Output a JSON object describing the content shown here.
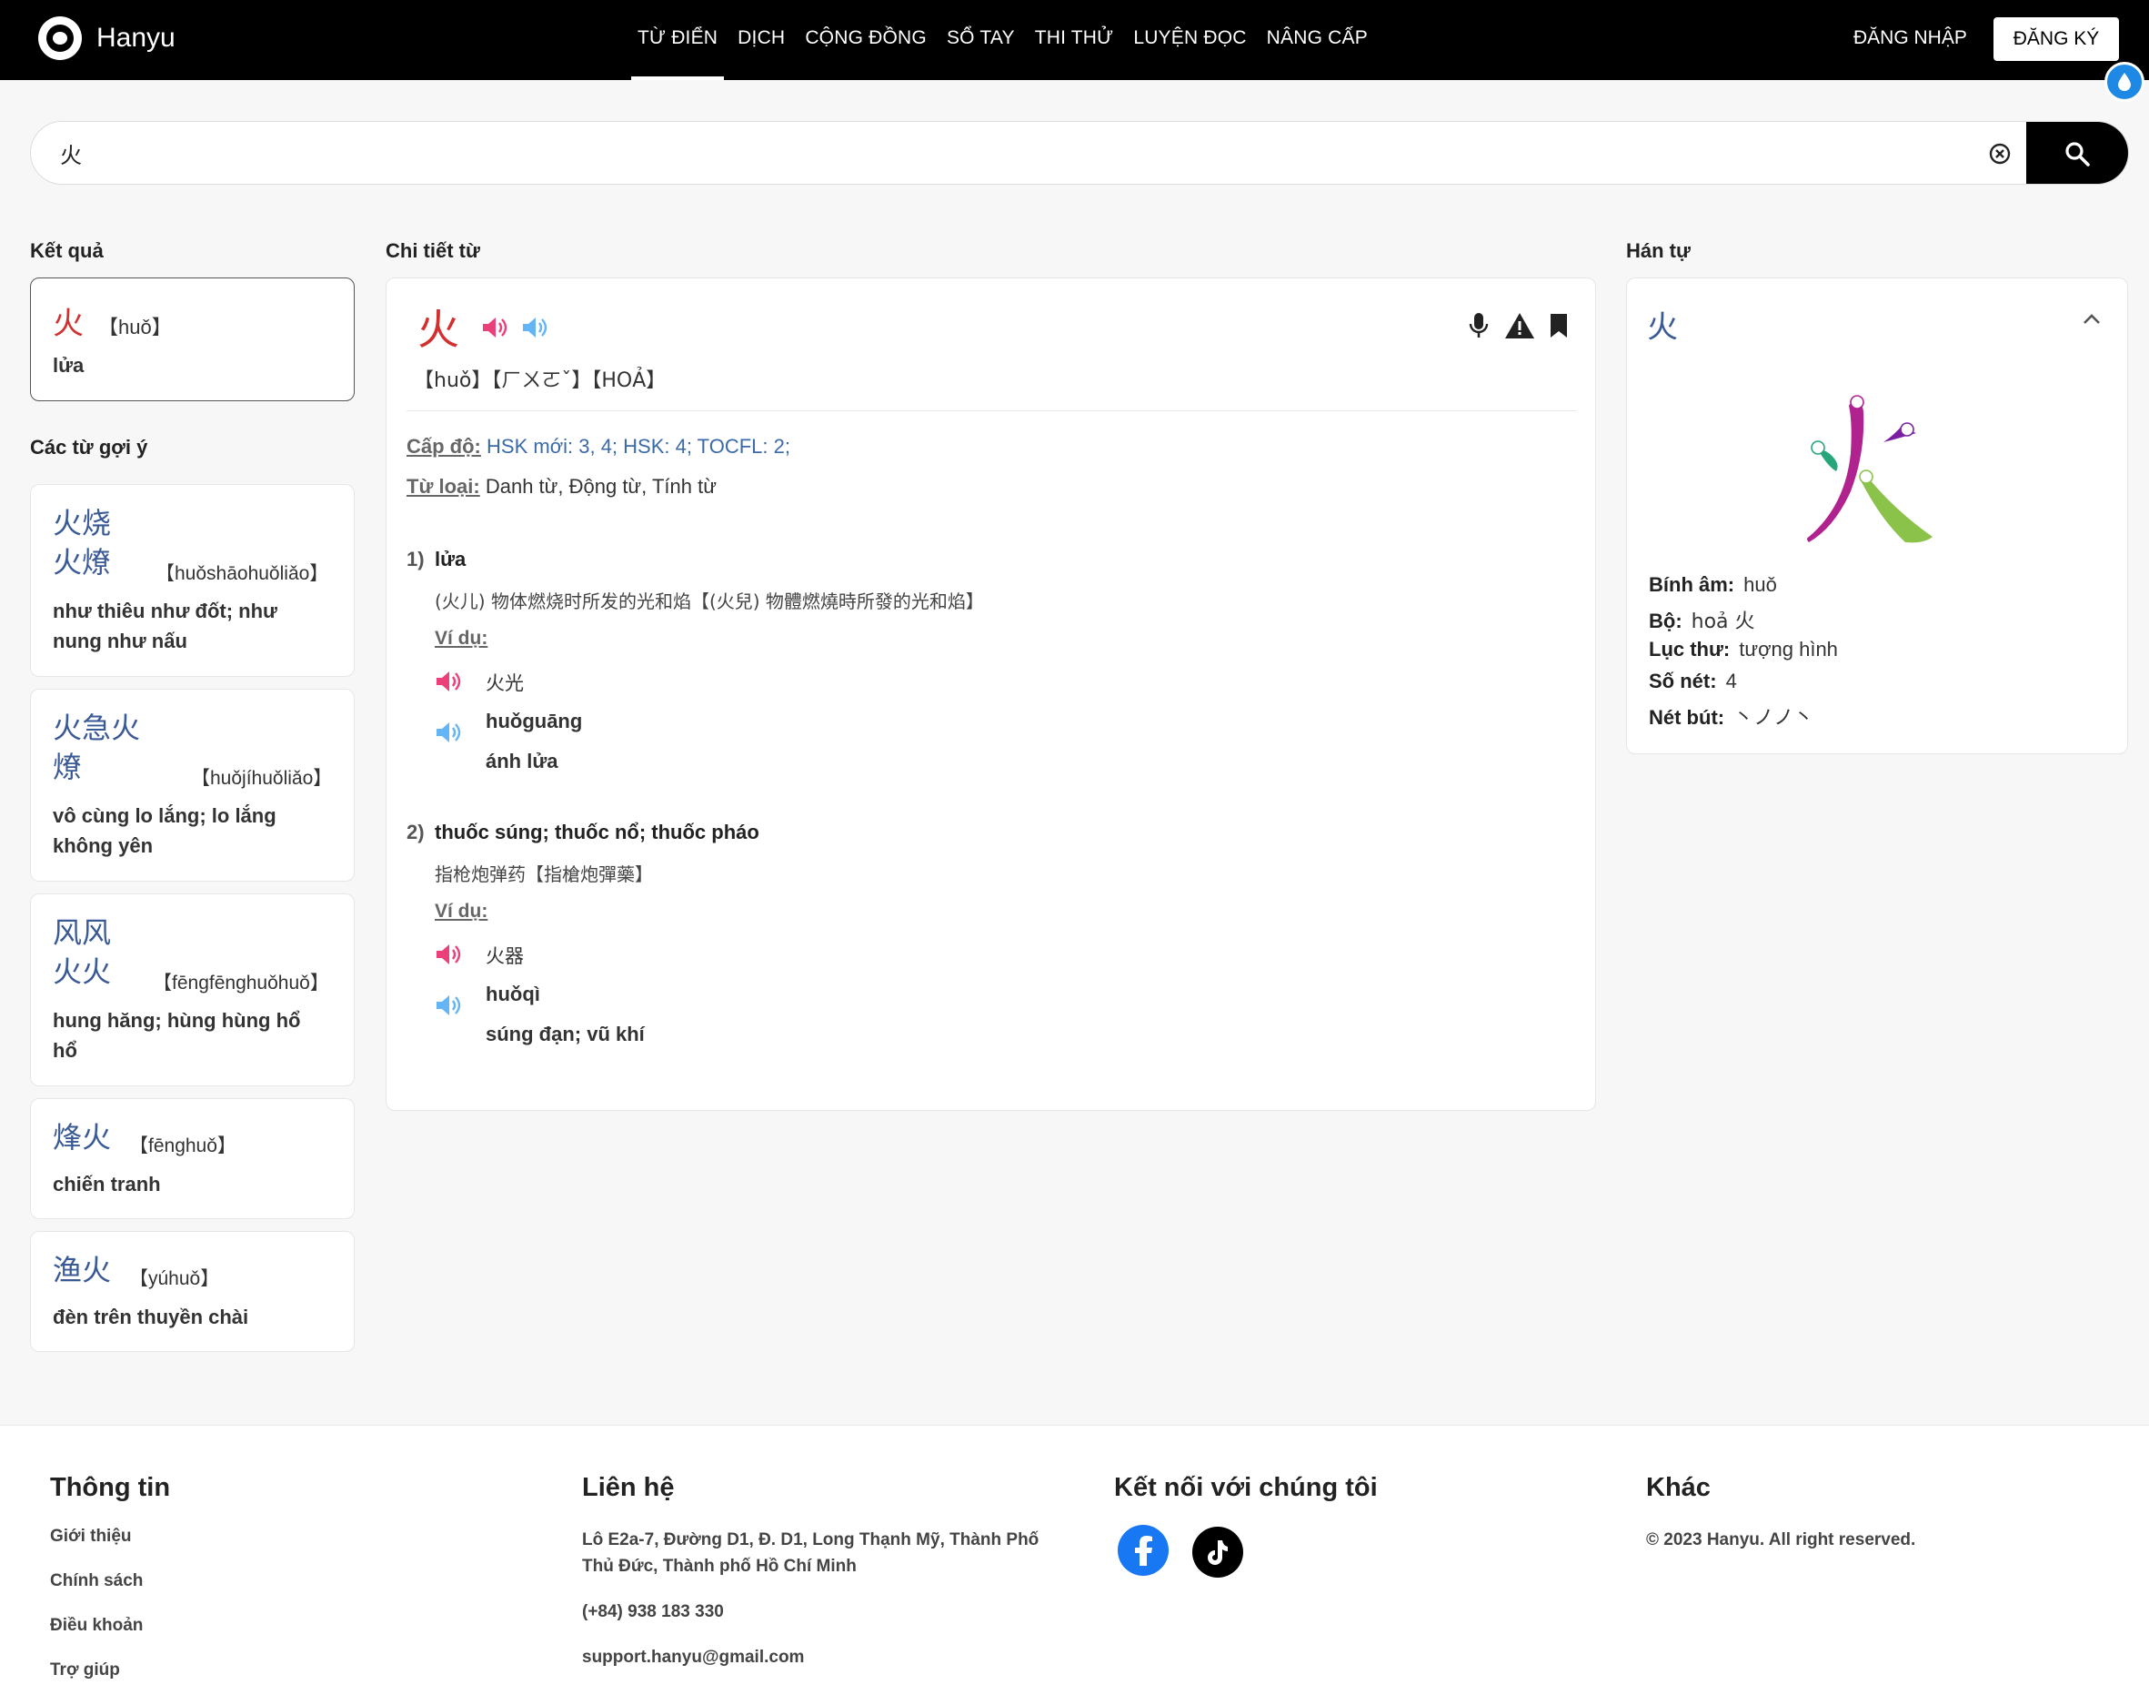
{
  "header": {
    "brand": "Hanyu",
    "nav": [
      {
        "label": "TỪ ĐIỂN",
        "active": true
      },
      {
        "label": "DỊCH"
      },
      {
        "label": "CỘNG ĐỒNG"
      },
      {
        "label": "SỔ TAY"
      },
      {
        "label": "THI THỬ"
      },
      {
        "label": "LUYỆN ĐỌC"
      },
      {
        "label": "NÂNG CẤP"
      }
    ],
    "login": "ĐĂNG NHẬP",
    "signup": "ĐĂNG KÝ"
  },
  "search": {
    "value": "火"
  },
  "results": {
    "title": "Kết quả",
    "item": {
      "hanzi": "火",
      "pinyin": "【huǒ】",
      "meaning": "lửa"
    }
  },
  "suggestions": {
    "title": "Các từ gợi ý",
    "items": [
      {
        "hanzi_line1": "火烧",
        "hanzi_line2": "火燎",
        "pinyin": "【huǒshāohuǒliǎo】",
        "meaning": "như thiêu như đốt; như nung như nấu"
      },
      {
        "hanzi_line1": "火急火",
        "hanzi_line2": "燎",
        "pinyin": "【huǒjíhuǒliǎo】",
        "meaning": "vô cùng lo lắng; lo lắng không yên"
      },
      {
        "hanzi_line1": "风风",
        "hanzi_line2": "火火",
        "pinyin": "【fēngfēnghuǒhuǒ】",
        "meaning": "hung hăng; hùng hùng hổ hổ"
      },
      {
        "hanzi_line1": "烽火",
        "hanzi_line2": "",
        "pinyin": "【fēnghuǒ】",
        "meaning": "chiến tranh"
      },
      {
        "hanzi_line1": "渔火",
        "hanzi_line2": "",
        "pinyin": "【yúhuǒ】",
        "meaning": "đèn trên thuyền chài"
      }
    ]
  },
  "detail": {
    "title": "Chi tiết từ",
    "hanzi": "火",
    "readings": "【huǒ】【ㄏㄨㄛˇ】【HOẢ】",
    "level_label": "Cấp độ:",
    "level_value": "HSK mới: 3, 4; HSK: 4; TOCFL: 2;",
    "pos_label": "Từ loại:",
    "pos_value": "Danh từ, Động từ, Tính từ",
    "example_label": "Ví dụ:",
    "senses": [
      {
        "num": "1)",
        "meaning": "lửa",
        "explain": "(火儿) 物体燃烧时所发的光和焰【(火兒) 物體燃燒時所發的光和焰】",
        "ex_hanzi": "火光",
        "ex_pinyin": "huǒguāng",
        "ex_meaning": "ánh lửa"
      },
      {
        "num": "2)",
        "meaning": "thuốc súng; thuốc nổ; thuốc pháo",
        "explain": "指枪炮弹药【指槍炮彈藥】",
        "ex_hanzi": "火器",
        "ex_pinyin": "huǒqì",
        "ex_meaning": "súng đạn; vũ khí"
      }
    ]
  },
  "hantu": {
    "title": "Hán tự",
    "char": "火",
    "props": [
      {
        "label": "Bính âm:",
        "value": "huǒ"
      },
      {
        "label": "Bộ:",
        "value": "hoả 火"
      },
      {
        "label": "Lục thư:",
        "value": "tượng hình"
      },
      {
        "label": "Số nét:",
        "value": "4"
      },
      {
        "label": "Nét bút:",
        "value": "丶ノノ丶"
      }
    ]
  },
  "footer": {
    "info_title": "Thông tin",
    "info_links": [
      "Giới thiệu",
      "Chính sách",
      "Điều khoản",
      "Trợ giúp"
    ],
    "contact_title": "Liên hệ",
    "address": "Lô E2a-7, Đường D1, Đ. D1, Long Thạnh Mỹ, Thành Phố Thủ Đức, Thành phố Hồ Chí Minh",
    "phone": "(+84) 938 183 330",
    "email": "support.hanyu@gmail.com",
    "social_title": "Kết nối với chúng tôi",
    "other_title": "Khác",
    "copyright": "© 2023 Hanyu. All right reserved."
  },
  "colors": {
    "header_bg": "#000000",
    "hanzi_red": "#d32f2f",
    "hanzi_blue": "#3a5a96",
    "speaker_pink": "#ec407a",
    "speaker_blue": "#64b5f6",
    "facebook": "#1877f2"
  },
  "icons": [
    "logo-icon",
    "water-drop-icon",
    "clear-icon",
    "search-icon",
    "speaker-icon",
    "mic-icon",
    "warning-icon",
    "bookmark-icon",
    "chevron-up-icon",
    "facebook-icon",
    "tiktok-icon"
  ]
}
